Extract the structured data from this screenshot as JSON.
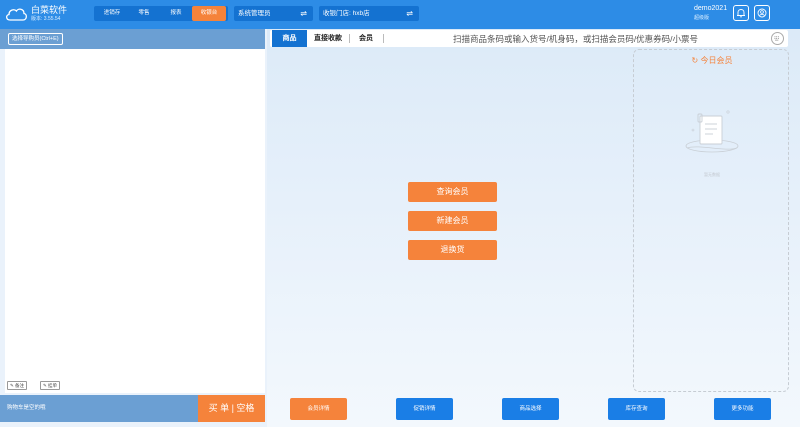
{
  "header": {
    "brand": "白菜软件",
    "version": "版本: 3.55.54",
    "nav": [
      "进销存",
      "零售",
      "报表",
      "收银台"
    ],
    "active_nav": "收银台",
    "operator_select": "系统管理员",
    "store_select": "收银门店: hxb店",
    "swap_symbol": "⇌",
    "user_name": "demo2021",
    "user_role": "超级版"
  },
  "left_panel": {
    "pick_button": "选择导购员(Ctrl+E)",
    "note_button": "备注",
    "hold_button": "挂单",
    "cart_status": "购物车是空的哦",
    "checkout_button": "买 单 | 空格"
  },
  "tabs": [
    "商品",
    "直接收款",
    "会员"
  ],
  "active_tab": "商品",
  "search": {
    "placeholder": "扫描商品条码或输入货号/机身码，或扫描会员码/优惠券码/小票号"
  },
  "member_panel": {
    "title": "今日会员",
    "empty_text": "暂无数据"
  },
  "actions": [
    "查询会员",
    "新建会员",
    "退换货"
  ],
  "footer_buttons": [
    "会员详情",
    "促销详情",
    "商品选择",
    "库存查询",
    "更多功能"
  ],
  "colors": {
    "primary": "#2d8ce6",
    "nav_dark": "#1472d1",
    "accent_orange": "#f5833b",
    "left_panel": "#6b9fd3"
  }
}
